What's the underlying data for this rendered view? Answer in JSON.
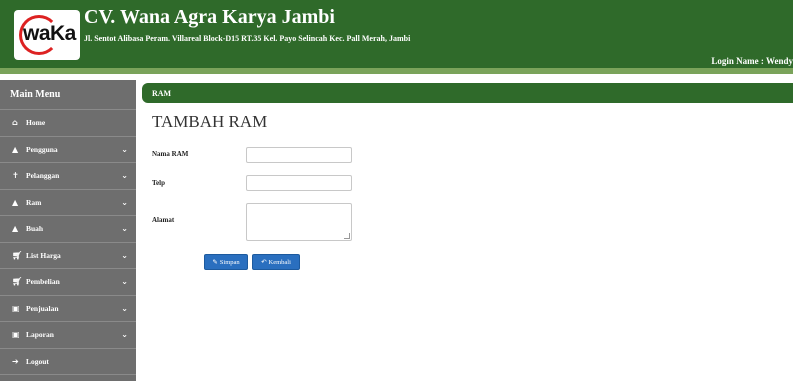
{
  "header": {
    "logo_text": "waKa",
    "company_name": "CV. Wana Agra Karya Jambi",
    "address": "Jl. Sentot Alibasa Peram. Villareal Block-D15 RT.35 Kel. Payo Selincah Kec. Pall Merah, Jambi",
    "login_label": "Login Name : Wendy"
  },
  "sidebar": {
    "title": "Main Menu",
    "items": [
      {
        "label": "Home",
        "icon": "home-icon"
      },
      {
        "label": "Pengguna",
        "icon": "user-icon"
      },
      {
        "label": "Pelanggan",
        "icon": "person-icon"
      },
      {
        "label": "Ram",
        "icon": "users-icon"
      },
      {
        "label": "Buah",
        "icon": "users-icon"
      },
      {
        "label": "List Harga",
        "icon": "cart-icon"
      },
      {
        "label": "Pembelian",
        "icon": "cart-icon"
      },
      {
        "label": "Penjualan",
        "icon": "money-icon"
      },
      {
        "label": "Laporan",
        "icon": "file-icon"
      },
      {
        "label": "Logout",
        "icon": "logout-icon"
      }
    ]
  },
  "main": {
    "section_title": "RAM",
    "page_title": "TAMBAH RAM",
    "form": {
      "nama_label": "Nama RAM",
      "nama_value": "",
      "telp_label": "Telp",
      "telp_value": "",
      "alamat_label": "Alamat",
      "alamat_value": ""
    },
    "buttons": {
      "save_label": "Simpan",
      "back_label": "Kembali"
    }
  },
  "colors": {
    "header_green": "#2f6a2a",
    "sidebar_gray": "#6e6e6e",
    "button_blue": "#2a6fbf"
  }
}
